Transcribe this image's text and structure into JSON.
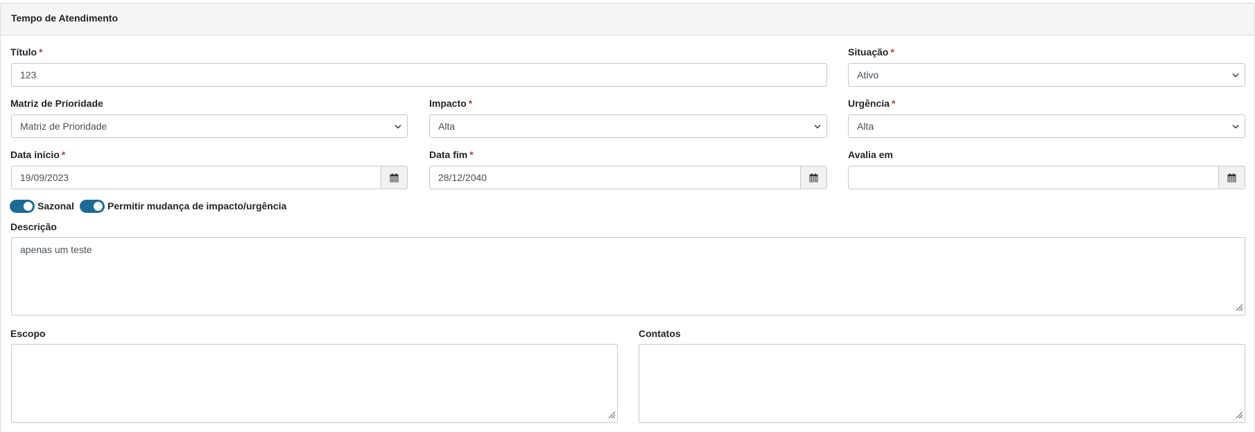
{
  "panel": {
    "title": "Tempo de Atendimento"
  },
  "required_marker": "*",
  "fields": {
    "titulo": {
      "label": "Título",
      "value": "123"
    },
    "situacao": {
      "label": "Situação",
      "value": "Ativo"
    },
    "matriz": {
      "label": "Matriz de Prioridade",
      "value": "Matriz de Prioridade"
    },
    "impacto": {
      "label": "Impacto",
      "value": "Alta"
    },
    "urgencia": {
      "label": "Urgência",
      "value": "Alta"
    },
    "data_inicio": {
      "label": "Data início",
      "value": "19/09/2023"
    },
    "data_fim": {
      "label": "Data fim",
      "value": "28/12/2040"
    },
    "avalia_em": {
      "label": "Avalia em",
      "value": ""
    },
    "descricao": {
      "label": "Descrição",
      "value": "apenas um teste"
    },
    "escopo": {
      "label": "Escopo",
      "value": ""
    },
    "contatos": {
      "label": "Contatos",
      "value": ""
    }
  },
  "toggles": {
    "sazonal": {
      "label": "Sazonal",
      "on": true
    },
    "permitir": {
      "label": "Permitir mudança de impacto/urgência",
      "on": true
    }
  },
  "icons": {
    "select": "chevron-down-icon",
    "date": "calendar-icon",
    "resize": "resize-grip-icon"
  },
  "colors": {
    "toggle_on": "#1c6a95",
    "required": "#a94442",
    "header_bg": "#f5f5f5"
  }
}
